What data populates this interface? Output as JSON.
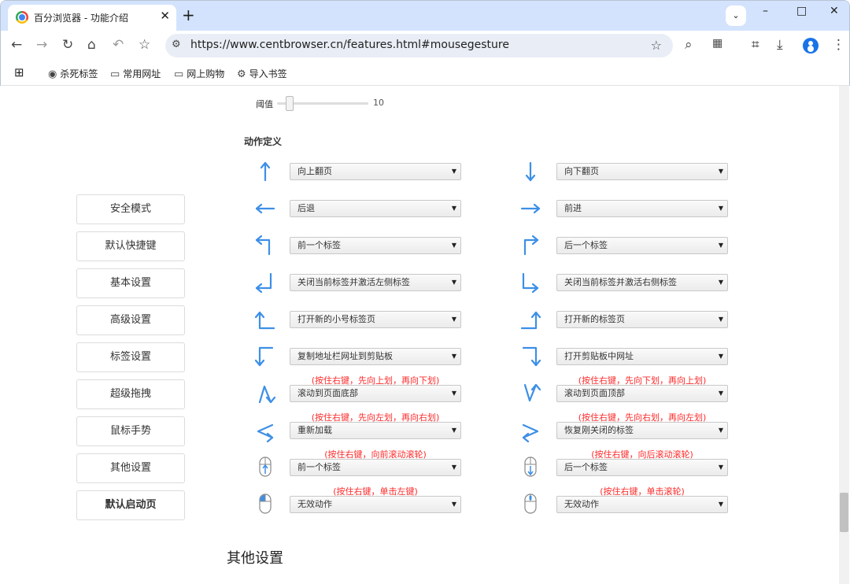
{
  "browser": {
    "tab_title": "百分浏览器 - 功能介绍",
    "tab_close": "✕",
    "new_tab": "+",
    "tab_search": "⌄",
    "window_controls": [
      "–",
      "□",
      "✕"
    ],
    "url": "https://www.centbrowser.cn/features.html#mousegesture",
    "bookmarks": [
      "杀死标签",
      "常用网址",
      "网上购物",
      "导入书签"
    ]
  },
  "sidebar": {
    "items": [
      "安全模式",
      "默认快捷键",
      "基本设置",
      "高级设置",
      "标签设置",
      "超级拖拽",
      "鼠标手势",
      "其他设置",
      "默认启动页"
    ],
    "active_index": 8
  },
  "threshold": {
    "label": "阈值",
    "value": "10",
    "level": 0.1
  },
  "section_title": "动作定义",
  "gestures": {
    "left": [
      {
        "icon": "up-arrow-icon",
        "value": "向上翻页",
        "hint": ""
      },
      {
        "icon": "left-arrow-icon",
        "value": "后退",
        "hint": ""
      },
      {
        "icon": "up-left-arrow-icon",
        "value": "前一个标签",
        "hint": ""
      },
      {
        "icon": "down-left-arrow-icon",
        "value": "关闭当前标签并激活左侧标签",
        "hint": ""
      },
      {
        "icon": "left-up-arrow-icon",
        "value": "打开新的小号标签页",
        "hint": ""
      },
      {
        "icon": "left-down-arrow-icon",
        "value": "复制地址栏网址到剪贴板",
        "hint": ""
      },
      {
        "icon": "up-down-stroke-icon",
        "value": "滚动到页面底部",
        "hint": "(按住右键，先向上划，再向下划)"
      },
      {
        "icon": "left-right-stroke-icon",
        "value": "重新加载",
        "hint": "(按住右键，先向左划，再向右划)"
      },
      {
        "icon": "mouse-scroll-up-icon",
        "value": "前一个标签",
        "hint": "(按住右键，向前滚动滚轮)"
      },
      {
        "icon": "mouse-left-click-icon",
        "value": "无效动作",
        "hint": "(按住右键，单击左键)"
      }
    ],
    "right": [
      {
        "icon": "down-arrow-icon",
        "value": "向下翻页",
        "hint": ""
      },
      {
        "icon": "right-arrow-icon",
        "value": "前进",
        "hint": ""
      },
      {
        "icon": "up-right-arrow-icon",
        "value": "后一个标签",
        "hint": ""
      },
      {
        "icon": "down-right-arrow-icon",
        "value": "关闭当前标签并激活右侧标签",
        "hint": ""
      },
      {
        "icon": "right-up-arrow-icon",
        "value": "打开新的标签页",
        "hint": ""
      },
      {
        "icon": "right-down-arrow-icon",
        "value": "打开剪贴板中网址",
        "hint": ""
      },
      {
        "icon": "down-up-stroke-icon",
        "value": "滚动到页面顶部",
        "hint": "(按住右键，先向下划，再向上划)"
      },
      {
        "icon": "right-left-stroke-icon",
        "value": "恢复刚关闭的标签",
        "hint": "(按住右键，先向右划，再向左划)"
      },
      {
        "icon": "mouse-scroll-down-icon",
        "value": "后一个标签",
        "hint": "(按住右键，向后滚动滚轮)"
      },
      {
        "icon": "mouse-middle-click-icon",
        "value": "无效动作",
        "hint": "(按住右键，单击滚轮)"
      }
    ]
  },
  "other_settings_heading": "其他设置",
  "colors": {
    "arrow": "#3d8fe6",
    "hint": "#ff2a2a",
    "tabstrip": "#d3e3fd"
  }
}
